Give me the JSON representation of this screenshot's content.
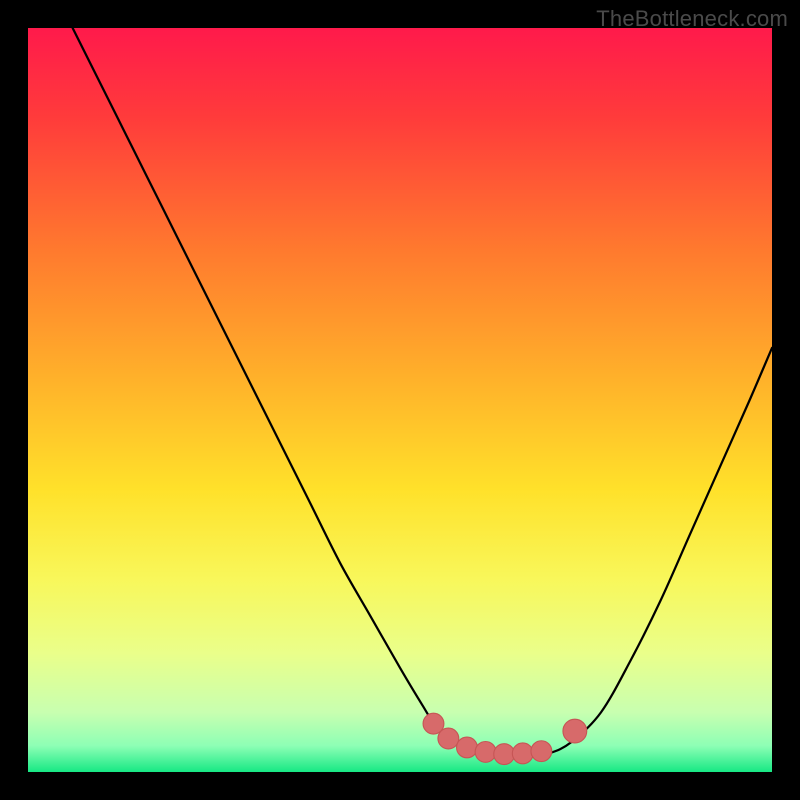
{
  "watermark": "TheBottleneck.com",
  "colors": {
    "black": "#000000",
    "curve": "#000000",
    "marker_fill": "#d76a6a",
    "marker_stroke": "#c65555"
  },
  "chart_data": {
    "type": "line",
    "title": "",
    "xlabel": "",
    "ylabel": "",
    "xlim": [
      0,
      100
    ],
    "ylim": [
      0,
      100
    ],
    "grid": false,
    "legend": false,
    "gradient_stops": [
      {
        "offset": 0.0,
        "color": "#ff1a4b"
      },
      {
        "offset": 0.12,
        "color": "#ff3b3b"
      },
      {
        "offset": 0.3,
        "color": "#ff7a2e"
      },
      {
        "offset": 0.48,
        "color": "#ffb42a"
      },
      {
        "offset": 0.62,
        "color": "#ffe12a"
      },
      {
        "offset": 0.74,
        "color": "#f8f75a"
      },
      {
        "offset": 0.84,
        "color": "#eaff8a"
      },
      {
        "offset": 0.92,
        "color": "#c8ffb0"
      },
      {
        "offset": 0.965,
        "color": "#8dffb5"
      },
      {
        "offset": 1.0,
        "color": "#17e884"
      }
    ],
    "series": [
      {
        "name": "bottleneck-curve",
        "x": [
          6,
          10,
          14,
          18,
          22,
          26,
          30,
          34,
          38,
          42,
          46,
          50,
          53,
          55,
          58,
          61,
          64,
          67,
          70,
          73,
          77,
          81,
          85,
          89,
          93,
          97,
          100
        ],
        "y": [
          100,
          92,
          84,
          76,
          68,
          60,
          52,
          44,
          36,
          28,
          21,
          14,
          9,
          6,
          4,
          2.5,
          2,
          2,
          2.5,
          4,
          8,
          15,
          23,
          32,
          41,
          50,
          57
        ]
      }
    ],
    "markers": [
      {
        "shape": "circle",
        "x": 54.5,
        "y": 6.5,
        "r": 1.4
      },
      {
        "shape": "circle",
        "x": 56.5,
        "y": 4.5,
        "r": 1.4
      },
      {
        "shape": "circle",
        "x": 59.0,
        "y": 3.3,
        "r": 1.4
      },
      {
        "shape": "circle",
        "x": 61.5,
        "y": 2.7,
        "r": 1.4
      },
      {
        "shape": "circle",
        "x": 64.0,
        "y": 2.4,
        "r": 1.4
      },
      {
        "shape": "circle",
        "x": 66.5,
        "y": 2.5,
        "r": 1.4
      },
      {
        "shape": "circle",
        "x": 69.0,
        "y": 2.8,
        "r": 1.4
      },
      {
        "shape": "circle",
        "x": 73.5,
        "y": 5.5,
        "r": 1.6
      }
    ]
  }
}
